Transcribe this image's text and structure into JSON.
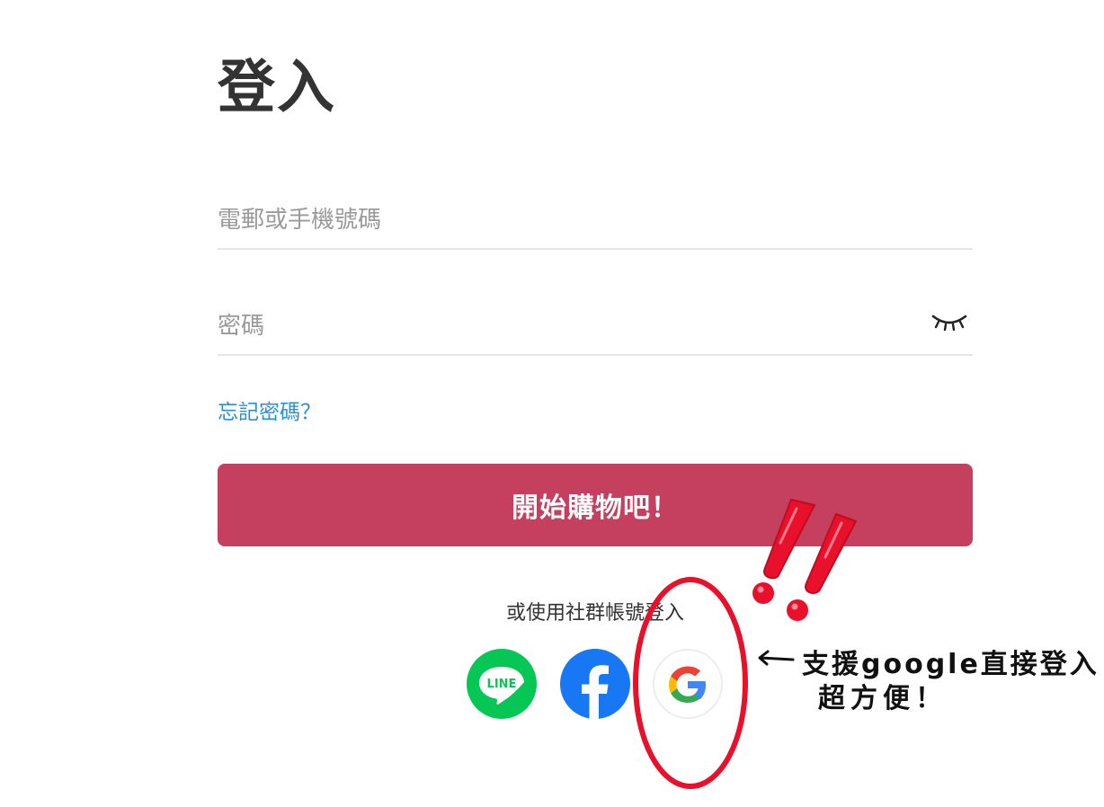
{
  "login": {
    "title": "登入",
    "email_placeholder": "電郵或手機號碼",
    "password_placeholder": "密碼",
    "forgot_password": "忘記密碼？",
    "submit_label": "開始購物吧！"
  },
  "social": {
    "caption": "或使用社群帳號登入",
    "buttons": [
      {
        "name": "line",
        "label": "LINE",
        "color": "#06c755"
      },
      {
        "name": "facebook",
        "icon": "facebook-f-icon",
        "color": "#1877f2"
      },
      {
        "name": "google",
        "icon": "google-g-icon",
        "colors": [
          "#4285f4",
          "#ea4335",
          "#fbbc05",
          "#34a853"
        ]
      }
    ]
  },
  "annotation": {
    "line1": "支援google直接登入",
    "line2": "超方便！",
    "circle_color": "#e8102a",
    "exclamation_color": "#e8102a"
  },
  "colors": {
    "primary_button": "#c5405e",
    "link": "#2b8fd6",
    "divider": "#e6e6e6"
  }
}
